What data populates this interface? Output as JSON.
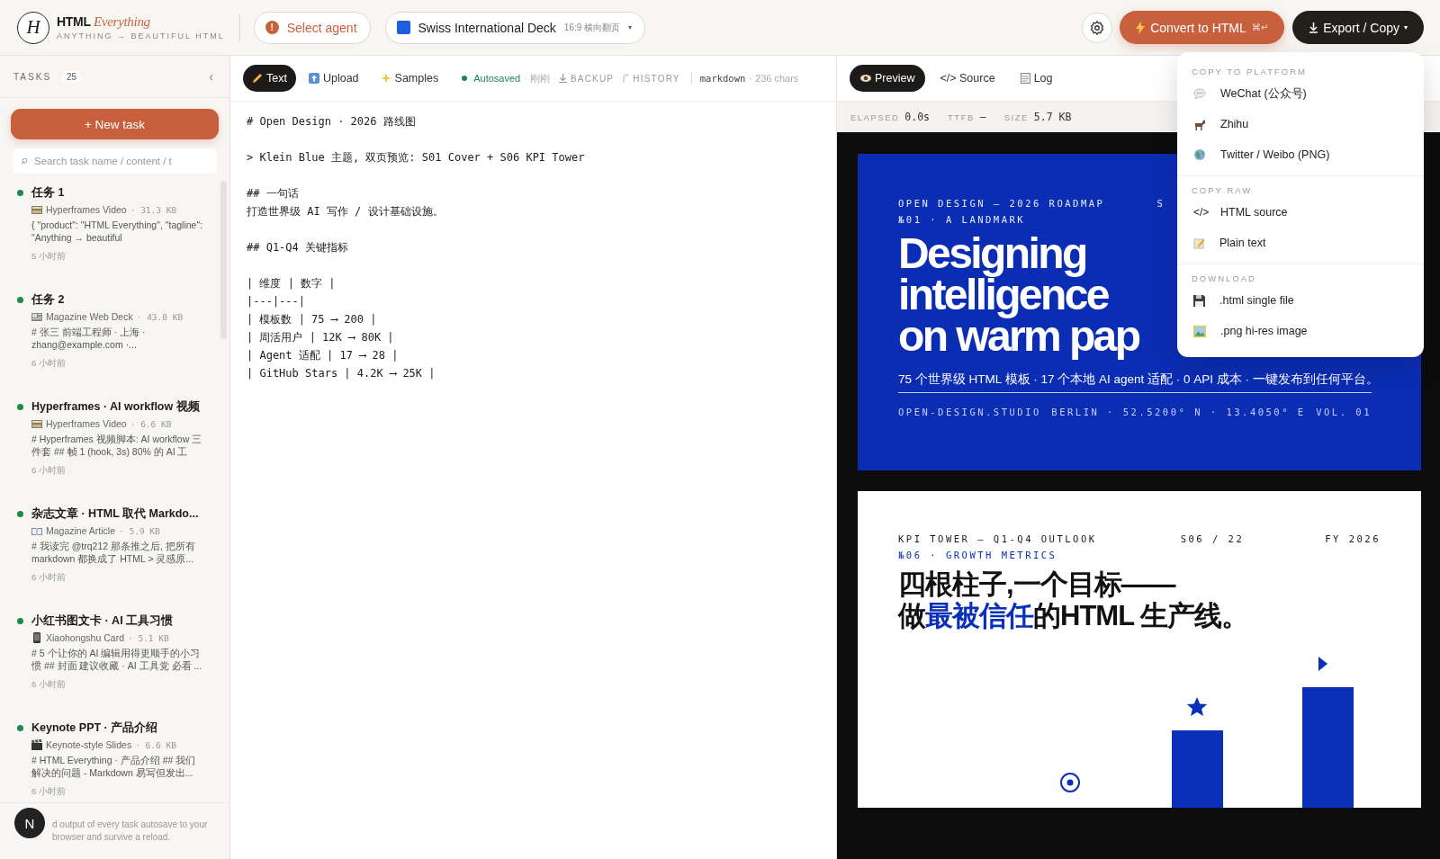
{
  "brand": {
    "name": "HTML",
    "name_italic": "Everything",
    "tagline": "ANYTHING → BEAUTIFUL HTML",
    "logo_letter": "H"
  },
  "agent_button": {
    "label": "Select agent",
    "icon": "!"
  },
  "template_picker": {
    "name": "Swiss International Deck",
    "meta": "16:9 横向翻页",
    "caret": "▾"
  },
  "convert_button": {
    "label": "Convert to HTML",
    "shortcut": "⌘↵"
  },
  "export_button": {
    "label": "Export / Copy",
    "caret": "▾"
  },
  "sidebar": {
    "title": "TASKS",
    "count": "25",
    "collapse": "‹",
    "new_task": "+ New task",
    "search": {
      "placeholder": "Search task name / content / t"
    },
    "tasks": [
      {
        "title": "任务 1",
        "kind": "film",
        "type": "Hyperframes Video",
        "size": "· 31.3 KB",
        "snippet": "{ \"product\": \"HTML Everything\", \"tagline\": \"Anything → beautiful",
        "time": "5 小时前"
      },
      {
        "title": "任务 2",
        "kind": "newspaper",
        "type": "Magazine Web Deck",
        "size": "· 43.0 KB",
        "snippet": "# 张三 前端工程师 · 上海 · zhang@example.com ·...",
        "time": "6 小时前"
      },
      {
        "title": "Hyperframes · AI workflow 视频",
        "kind": "film",
        "type": "Hyperframes Video",
        "size": "· 6.6 KB",
        "snippet": "# Hyperframes 视频脚本: AI workflow 三件套 ## 帧 1 (hook, 3s) 80% 的 AI 工",
        "time": "6 小时前"
      },
      {
        "title": "杂志文章 · HTML 取代 Markdo...",
        "kind": "book",
        "type": "Magazine Article",
        "size": "· 5.9 KB",
        "snippet": "# 我读完 @trq212 那条推之后, 把所有 markdown 都换成了 HTML > 灵感原...",
        "time": "6 小时前"
      },
      {
        "title": "小红书图文卡 · AI 工具习惯",
        "kind": "phone",
        "type": "Xiaohongshu Card",
        "size": "· 5.1 KB",
        "snippet": "# 5 个让你的 AI 编辑用得更顺手的小习惯 ## 封面 建议收藏 · AI 工具党 必看 ...",
        "time": "6 小时前"
      },
      {
        "title": "Keynote PPT · 产品介绍",
        "kind": "clapper",
        "type": "Keynote-style Slides",
        "size": "· 6.6 KB",
        "snippet": "# HTML Everything · 产品介绍 ## 我们解决的问题 - Markdown 易写但发出...",
        "time": "6 小时前"
      }
    ],
    "note": "d output of every task autosave to your browser and survive a reload.",
    "avatar": "N"
  },
  "editor": {
    "tabs": [
      {
        "label": "Text",
        "kind": "pencil",
        "selected": true
      },
      {
        "label": "Upload",
        "kind": "upload",
        "selected": false
      },
      {
        "label": "Samples",
        "kind": "sparkle",
        "selected": false
      }
    ],
    "autosave": {
      "label": "Autosaved",
      "time": "· 刚刚"
    },
    "backup": "BACKUP",
    "history": "HISTORY",
    "format": "markdown",
    "chars": "· 236 chars",
    "blocks": [
      [
        "# Open Design · 2026 路线图"
      ],
      [
        "> Klein Blue 主题, 双页预览: S01 Cover + S06 KPI Tower"
      ],
      [
        "## 一句话",
        "打造世界级 AI 写作 / 设计基础设施。"
      ],
      [
        "## Q1-Q4 关键指标"
      ],
      [
        "| 维度 | 数字 |",
        "|---|---|",
        "| 模板数 | 75 ⟶ 200 |",
        "| 周活用户 | 12K ⟶ 80K |",
        "| Agent 适配 | 17 ⟶ 28 |",
        "| GitHub Stars | 4.2K ⟶ 25K |"
      ]
    ]
  },
  "preview": {
    "tabs": [
      {
        "label": "Preview",
        "kind": "eye",
        "selected": true
      },
      {
        "label": "</> Source",
        "kind": "none",
        "selected": false
      },
      {
        "label": "Log",
        "kind": "notepad",
        "selected": false
      }
    ],
    "stats": [
      {
        "label": "ELAPSED",
        "value": "0.0s"
      },
      {
        "label": "TTFB",
        "value": "—"
      },
      {
        "label": "SIZE",
        "value": "5.7 KB"
      }
    ],
    "cover": {
      "kicker": "OPEN DESIGN — 2026 ROADMAP",
      "kicker_right": "S",
      "number": "№01 · A LANDMARK",
      "heading": [
        "Designing",
        "intelligence",
        "on warm pap"
      ],
      "subtitle": "75 个世界级 HTML 模板 · 17 个本地 AI agent 适配 · 0 API 成本 · 一键发布到任何平台。",
      "footer": [
        "OPEN-DESIGN.STUDIO",
        "BERLIN · 52.5200° N · 13.4050° E",
        "VOL. 01"
      ]
    },
    "kpi": {
      "kicker": "KPI TOWER — Q1-Q4 OUTLOOK",
      "page": "S06 / 22",
      "year": "FY 2026",
      "number": "№06 · GROWTH METRICS",
      "heading_line1": "四根柱子,一个目标——",
      "heading_line2": [
        {
          "text": "做",
          "highlight": false
        },
        {
          "text": "最被信任",
          "highlight": true
        },
        {
          "text": "的HTML 生产线。",
          "highlight": false
        }
      ]
    }
  },
  "export_menu": [
    {
      "title": "COPY TO PLATFORM",
      "items": [
        {
          "label": "WeChat (公众号)",
          "kind": "chat"
        },
        {
          "label": "Zhihu",
          "kind": "animal"
        },
        {
          "label": "Twitter / Weibo (PNG)",
          "kind": "globe"
        }
      ]
    },
    {
      "title": "COPY RAW",
      "items": [
        {
          "label": "HTML source",
          "kind": "code",
          "glyph": "</>"
        },
        {
          "label": "Plain text",
          "kind": "notepad"
        }
      ]
    },
    {
      "title": "DOWNLOAD",
      "items": [
        {
          "label": ".html single file",
          "kind": "floppy"
        },
        {
          "label": ".png hi-res image",
          "kind": "image"
        }
      ]
    }
  ]
}
